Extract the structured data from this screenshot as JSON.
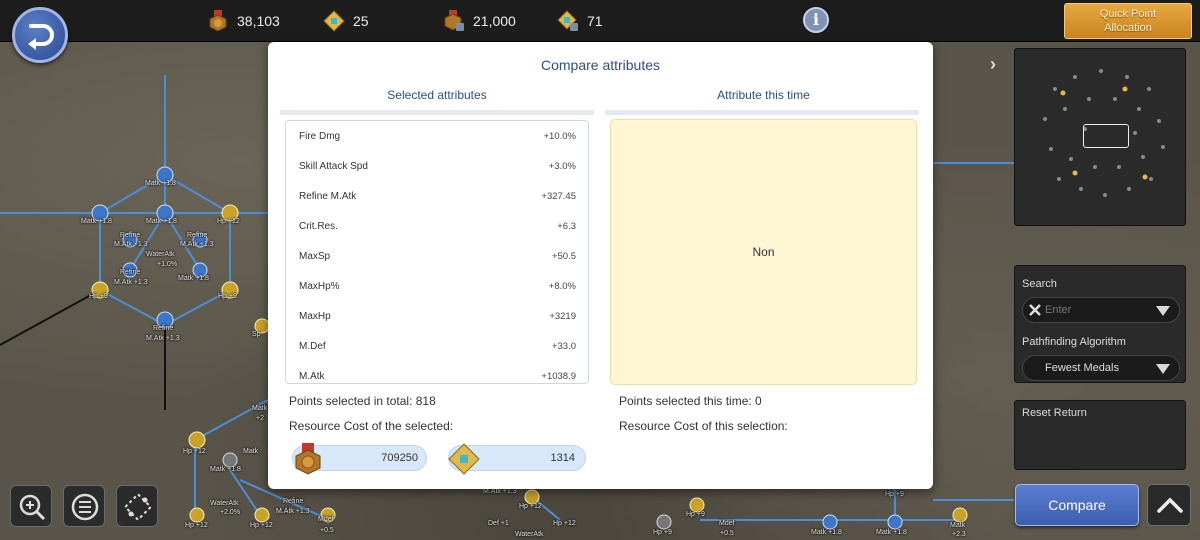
{
  "topbar": {
    "resources": [
      {
        "icon": "red-medal-icon",
        "value": "38,103"
      },
      {
        "icon": "gold-crystal-icon",
        "value": "25"
      },
      {
        "icon": "locked-red-medal-icon",
        "value": "21,000"
      },
      {
        "icon": "locked-gold-crystal-icon",
        "value": "71"
      }
    ],
    "info_label": "i",
    "quick_point_line1": "Quick Point",
    "quick_point_line2": "Allocation"
  },
  "modal": {
    "title": "Compare attributes",
    "selected_header": "Selected attributes",
    "this_time_header": "Attribute this time",
    "attributes": [
      {
        "name": "Fire Dmg",
        "value": "+10.0%"
      },
      {
        "name": "Skill Attack Spd",
        "value": "+3.0%"
      },
      {
        "name": "Refine M.Atk",
        "value": "+327.45"
      },
      {
        "name": "Crit.Res.",
        "value": "+6.3"
      },
      {
        "name": "MaxSp",
        "value": "+50.5"
      },
      {
        "name": "MaxHp%",
        "value": "+8.0%"
      },
      {
        "name": "MaxHp",
        "value": "+3219"
      },
      {
        "name": "M.Def",
        "value": "+33.0"
      },
      {
        "name": "M.Atk",
        "value": "+1038.9"
      }
    ],
    "this_time_value": "Non",
    "points_total": "Points selected in total: 818",
    "points_this_time": "Points selected this time: 0",
    "resource_cost_selected": "Resource Cost of the selected:",
    "resource_cost_this": "Resource Cost of this selection:",
    "cost_medal": "709250",
    "cost_crystal": "1314"
  },
  "sidebar": {
    "search_label": "Search",
    "search_placeholder": "Enter",
    "path_label": "Pathfinding Algorithm",
    "path_value": "Fewest Medals",
    "reset_label": "Reset Return",
    "compare_label": "Compare"
  },
  "tree_labels": [
    "Matk +1.8",
    "Matk +1.8",
    "Matk +1.8",
    "Hp +12",
    "Refine",
    "M.Atk +1.3",
    "Refine",
    "M.Atk +1.3",
    "WaterAtk",
    "+1.0%",
    "Refine",
    "M.Atk +1.3",
    "Matk +1.8",
    "Hp +9",
    "Hp +9",
    "Refine",
    "M.Atk +1.3",
    "Sp",
    "Matk",
    "+2",
    "Hp +12",
    "Matk",
    "Matk +1.8",
    "WaterAtk",
    "+2.0%",
    "Refine",
    "M.Atk +1.3",
    "Hp +12",
    "Hp +12",
    "Mdef",
    "+0.5",
    "M.Atk +1.3",
    "Hp +12",
    "Def +1",
    "Hp +12",
    "WaterAtk",
    "Hp +9",
    "Hp +9",
    "Mdef",
    "+0.5",
    "Matk +1.8",
    "Matk +1.8",
    "Matk",
    "+2.3",
    "Hp +9"
  ],
  "colors": {
    "accent_blue": "#2d4f86",
    "compare_button": "#4a6cc4",
    "quick_point": "#d8962c",
    "pill": "#d6e8f9",
    "this_time_box": "#fff6d4"
  }
}
